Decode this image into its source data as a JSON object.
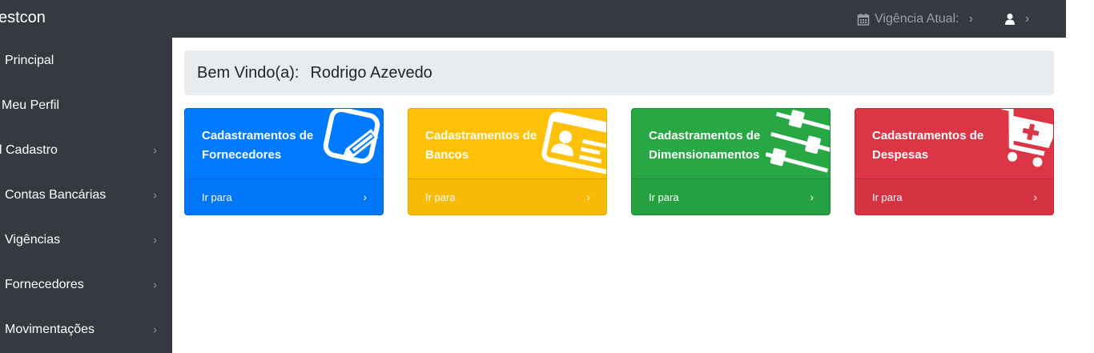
{
  "brand": "estcon",
  "topbar": {
    "vigencia_label": "Vigência Atual:",
    "chevron": "›",
    "icons": [
      "calendar-icon",
      "user-icon"
    ]
  },
  "sidebar": {
    "items": [
      {
        "label": "Principal",
        "has_arrow": false
      },
      {
        "label": "Meu Perfil",
        "has_arrow": false
      },
      {
        "label": "l Cadastro",
        "has_arrow": true
      },
      {
        "label": "Contas Bancárias",
        "has_arrow": true
      },
      {
        "label": "Vigências",
        "has_arrow": true
      },
      {
        "label": "Fornecedores",
        "has_arrow": true
      },
      {
        "label": "Movimentações",
        "has_arrow": true
      }
    ],
    "arrow": "›"
  },
  "welcome": {
    "prefix": "Bem Vindo(a):",
    "name": "Rodrigo Azevedo"
  },
  "cards": [
    {
      "title": "Cadastramentos de Fornecedores",
      "link": "Ir para",
      "icon": "edit-icon",
      "color": "#007bff"
    },
    {
      "title": "Cadastramentos de Bancos",
      "link": "Ir para",
      "icon": "id-card-icon",
      "color": "#ffc107"
    },
    {
      "title": "Cadastramentos de Dimensionamentos",
      "link": "Ir para",
      "icon": "sliders-icon",
      "color": "#28a745"
    },
    {
      "title": "Cadastramentos de Despesas",
      "link": "Ir para",
      "icon": "cart-plus-icon",
      "color": "#dc3545"
    }
  ],
  "card_chevron": "›"
}
